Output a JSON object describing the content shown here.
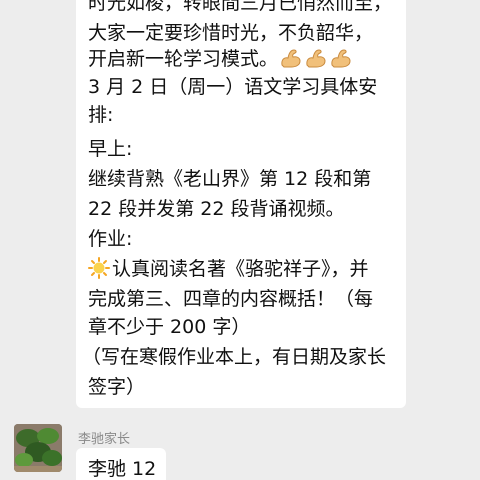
{
  "message1": {
    "lines": [
      "时光如梭，转眼間三月已悄然而至，",
      "大家一定要珍惜时光，不负韶华，",
      "开启新一轮学习模式。",
      "3 月 2 日（周一）语文学习具体安",
      "排:",
      "早上:",
      "继续背熟《老山界》第 12 段和第",
      "22 段并发第 22 段背诵视频。",
      "作业:",
      "认真阅读名著《骆驼祥子》，并",
      "完成第三、四章的内容概括！（每",
      "章不少于 200 字）",
      "（写在寒假作业本上，有日期及家长",
      "签字）"
    ],
    "emoji_icons": [
      "flexed-biceps-icon",
      "sun-icon"
    ]
  },
  "message2": {
    "sender": "李驰家长",
    "text": "李驰 12"
  }
}
